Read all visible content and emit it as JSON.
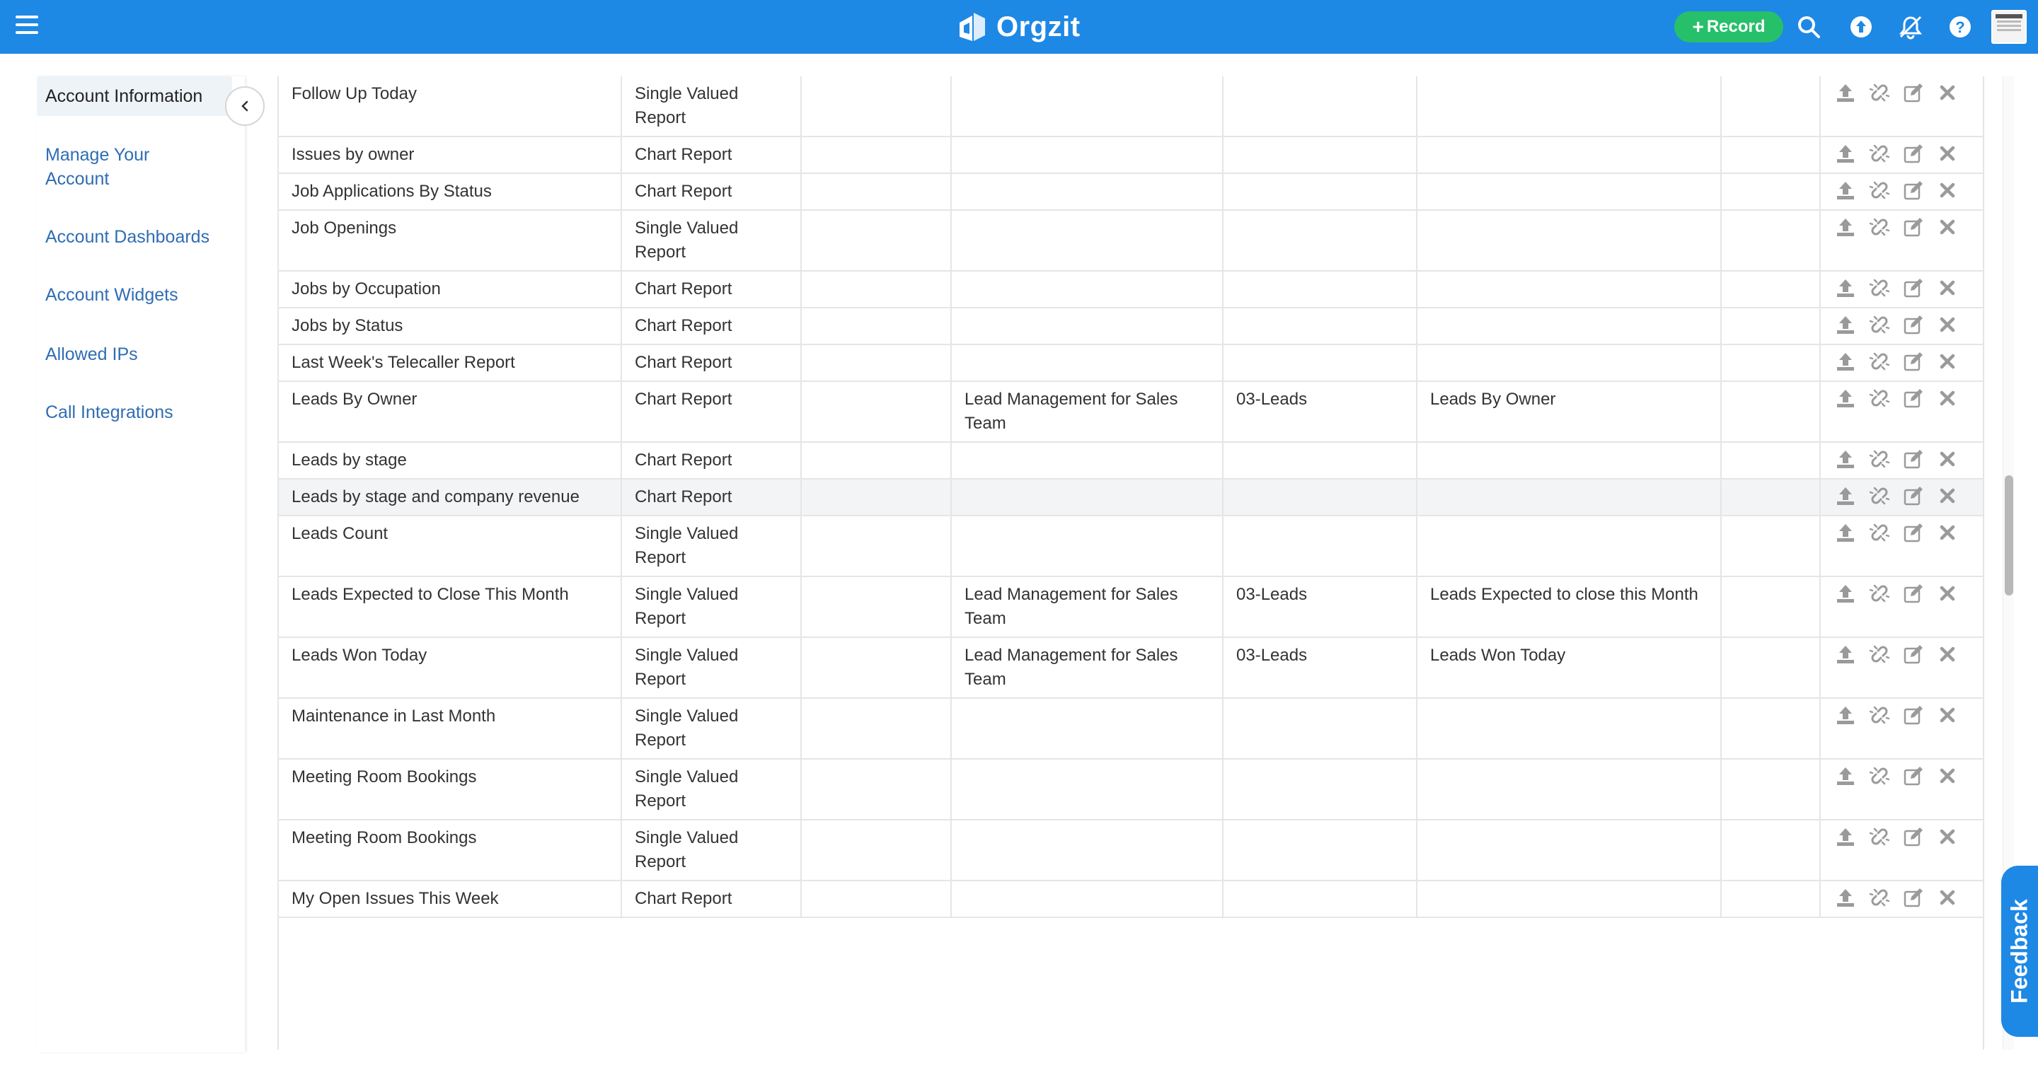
{
  "app": {
    "name": "Orgzit"
  },
  "header": {
    "record_label": "Record"
  },
  "colors": {
    "brand": "#1e88e5",
    "record": "#27c06a",
    "link": "#2f6db3"
  },
  "sidebar": {
    "items": [
      {
        "label": "Account Information",
        "active": true
      },
      {
        "label": "Manage Your Account",
        "active": false
      },
      {
        "label": "Account Dashboards",
        "active": false
      },
      {
        "label": "Account Widgets",
        "active": false
      },
      {
        "label": "Allowed IPs",
        "active": false
      },
      {
        "label": "Call Integrations",
        "active": false
      }
    ]
  },
  "table": {
    "rows": [
      {
        "name": "Follow Up Today",
        "type": "Single Valued Report",
        "c3": "",
        "c4": "",
        "c5": "",
        "c6": "",
        "c7": ""
      },
      {
        "name": "Issues by owner",
        "type": "Chart Report",
        "c3": "",
        "c4": "",
        "c5": "",
        "c6": "",
        "c7": ""
      },
      {
        "name": "Job Applications By Status",
        "type": "Chart Report",
        "c3": "",
        "c4": "",
        "c5": "",
        "c6": "",
        "c7": ""
      },
      {
        "name": "Job Openings",
        "type": "Single Valued Report",
        "c3": "",
        "c4": "",
        "c5": "",
        "c6": "",
        "c7": ""
      },
      {
        "name": "Jobs by Occupation",
        "type": "Chart Report",
        "c3": "",
        "c4": "",
        "c5": "",
        "c6": "",
        "c7": ""
      },
      {
        "name": "Jobs by Status",
        "type": "Chart Report",
        "c3": "",
        "c4": "",
        "c5": "",
        "c6": "",
        "c7": ""
      },
      {
        "name": "Last Week's Telecaller Report",
        "type": "Chart Report",
        "c3": "",
        "c4": "",
        "c5": "",
        "c6": "",
        "c7": ""
      },
      {
        "name": "Leads By Owner",
        "type": "Chart Report",
        "c3": "",
        "c4": "Lead Management for Sales Team",
        "c5": "03-Leads",
        "c6": "Leads By Owner",
        "c7": ""
      },
      {
        "name": "Leads by stage",
        "type": "Chart Report",
        "c3": "",
        "c4": "",
        "c5": "",
        "c6": "",
        "c7": ""
      },
      {
        "name": "Leads by stage and company revenue",
        "type": "Chart Report",
        "c3": "",
        "c4": "",
        "c5": "",
        "c6": "",
        "c7": "",
        "highlight": true
      },
      {
        "name": "Leads Count",
        "type": "Single Valued Report",
        "c3": "",
        "c4": "",
        "c5": "",
        "c6": "",
        "c7": ""
      },
      {
        "name": "Leads Expected to Close This Month",
        "type": "Single Valued Report",
        "c3": "",
        "c4": "Lead Management for Sales Team",
        "c5": "03-Leads",
        "c6": "Leads Expected to close this Month",
        "c7": ""
      },
      {
        "name": "Leads Won Today",
        "type": "Single Valued Report",
        "c3": "",
        "c4": "Lead Management for Sales Team",
        "c5": "03-Leads",
        "c6": "Leads Won Today",
        "c7": ""
      },
      {
        "name": "Maintenance in Last Month",
        "type": "Single Valued Report",
        "c3": "",
        "c4": "",
        "c5": "",
        "c6": "",
        "c7": ""
      },
      {
        "name": "Meeting Room Bookings",
        "type": "Single Valued Report",
        "c3": "",
        "c4": "",
        "c5": "",
        "c6": "",
        "c7": ""
      },
      {
        "name": "Meeting Room Bookings",
        "type": "Single Valued Report",
        "c3": "",
        "c4": "",
        "c5": "",
        "c6": "",
        "c7": ""
      },
      {
        "name": "My Open Issues This Week",
        "type": "Chart Report",
        "c3": "",
        "c4": "",
        "c5": "",
        "c6": "",
        "c7": ""
      }
    ]
  },
  "feedback": {
    "label": "Feedback"
  }
}
